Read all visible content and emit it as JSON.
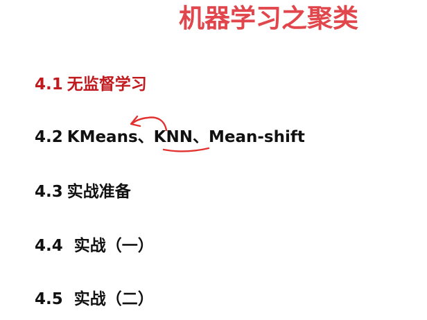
{
  "page": {
    "title": "机器学习之聚类"
  },
  "toc": {
    "items": [
      {
        "number": "4.1",
        "text": "无监督学习"
      },
      {
        "number": "4.2",
        "text_a": "KMeans、",
        "text_b": "KNN",
        "text_c": "、Mean-shift"
      },
      {
        "number": "4.3",
        "text": "实战准备"
      },
      {
        "number": "4.4",
        "text": "实战（一）"
      },
      {
        "number": "4.5",
        "text": "实战（二）"
      }
    ]
  },
  "colors": {
    "title": "#e0464b",
    "active_item": "#c0191e",
    "annotation": "#e2312f",
    "text": "#111111"
  }
}
